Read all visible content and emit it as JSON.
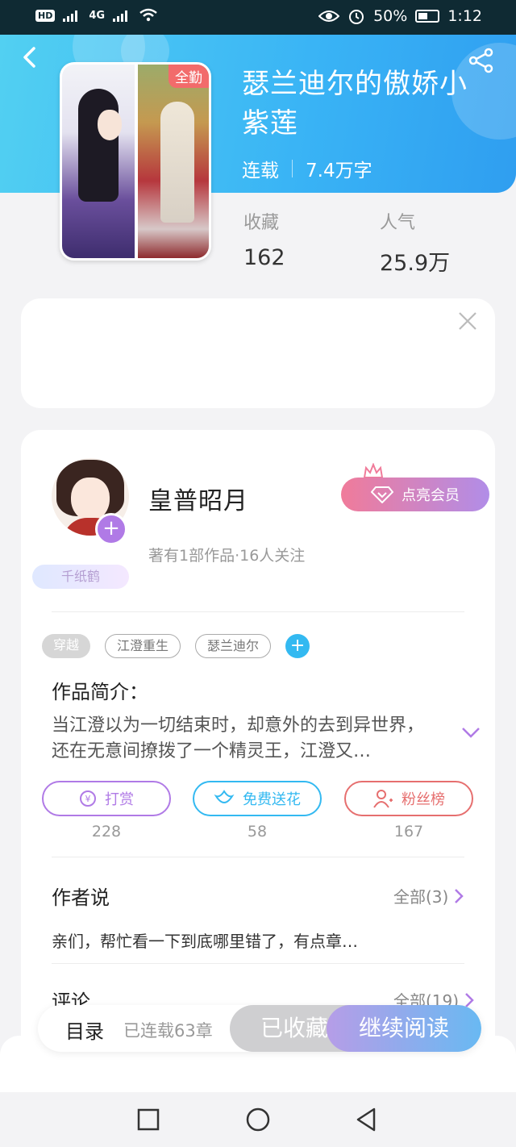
{
  "status_bar": {
    "hd": "HD",
    "network": "4G",
    "battery": "50%",
    "time": "1:12"
  },
  "book": {
    "title": "瑟兰迪尔的傲娇小紫莲",
    "badge": "全勤",
    "status": "连载",
    "word_count": "7.4万字",
    "stats": [
      {
        "label": "收藏",
        "value": "162"
      },
      {
        "label": "人气",
        "value": "25.9万"
      }
    ]
  },
  "author": {
    "name": "皇普昭月",
    "stats": "著有1部作品·16人关注",
    "ribbon": "千纸鹤",
    "vip_label": "点亮会员"
  },
  "tags": [
    "穿越",
    "江澄重生",
    "瑟兰迪尔"
  ],
  "intro": {
    "title": "作品简介：",
    "text": "当江澄以为一切结束时，却意外的去到异世界，还在无意间撩拨了一个精灵王，江澄又…"
  },
  "actions": [
    {
      "label": "打赏",
      "count": "228",
      "color": "#b07ae6"
    },
    {
      "label": "免费送花",
      "count": "58",
      "color": "#33b9f1"
    },
    {
      "label": "粉丝榜",
      "count": "167",
      "color": "#e66f6f"
    }
  ],
  "author_says": {
    "title": "作者说",
    "more": "全部(3)",
    "note": "亲们，帮忙看一下到底哪里错了，有点章…"
  },
  "comments": {
    "title": "评论",
    "more": "全部(19)"
  },
  "bottom_bar": {
    "toc": "目录",
    "chapters": "已连载63章",
    "collected": "已收藏",
    "read": "继续阅读"
  },
  "colors": {
    "header_start": "#52d0f2",
    "header_end": "#2f9ef0",
    "accent_purple": "#b07ae6",
    "accent_blue": "#33b9f1"
  }
}
